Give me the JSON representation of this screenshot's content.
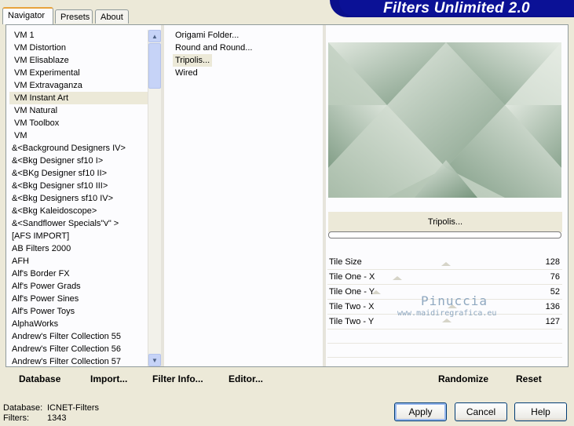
{
  "banner": {
    "title": "Filters Unlimited 2.0"
  },
  "tabs": [
    {
      "label": "Navigator",
      "active": true
    },
    {
      "label": "Presets",
      "active": false
    },
    {
      "label": "About",
      "active": false
    }
  ],
  "categories": [
    "VM 1",
    "VM Distortion",
    "VM Elisablaze",
    "VM Experimental",
    "VM Extravaganza",
    "VM Instant Art",
    "VM Natural",
    "VM Toolbox",
    "VM",
    "&<Background Designers IV>",
    "&<Bkg Designer sf10 I>",
    "&<BKg Designer sf10 II>",
    "&<Bkg Designer sf10 III>",
    "&<Bkg Designers sf10 IV>",
    "&<Bkg Kaleidoscope>",
    "&<Sandflower Specials\"v\" >",
    "[AFS IMPORT]",
    "AB Filters 2000",
    "AFH",
    "Alf's Border FX",
    "Alf's Power Grads",
    "Alf's Power Sines",
    "Alf's Power Toys",
    "AlphaWorks",
    "Andrew's Filter Collection 55",
    "Andrew's Filter Collection 56",
    "Andrew's Filter Collection 57"
  ],
  "selected_category": "VM Instant Art",
  "filters": [
    "Origami Folder...",
    "Round and Round...",
    "Tripolis...",
    "Wired"
  ],
  "selected_filter": "Tripolis...",
  "preview": {
    "caption": "Tripolis...",
    "colors": {
      "dark": "#6f8f76",
      "mid": "#a8bca9",
      "light": "#e6ece4"
    }
  },
  "params": [
    {
      "label": "Tile Size",
      "value": "128"
    },
    {
      "label": "Tile One - X",
      "value": "76"
    },
    {
      "label": "Tile One - Y",
      "value": "52"
    },
    {
      "label": "Tile Two - X",
      "value": "136"
    },
    {
      "label": "Tile Two - Y",
      "value": "127"
    }
  ],
  "watermark": {
    "name": "Pinuccia",
    "url": "www.maidiregrafica.eu"
  },
  "actions": {
    "database": "Database",
    "import": "Import...",
    "filter_info": "Filter Info...",
    "editor": "Editor...",
    "randomize": "Randomize",
    "reset": "Reset"
  },
  "status": {
    "database_label": "Database:",
    "database_value": "ICNET-Filters",
    "filters_label": "Filters:",
    "filters_value": "1343"
  },
  "buttons": {
    "apply": "Apply",
    "cancel": "Cancel",
    "help": "Help"
  }
}
